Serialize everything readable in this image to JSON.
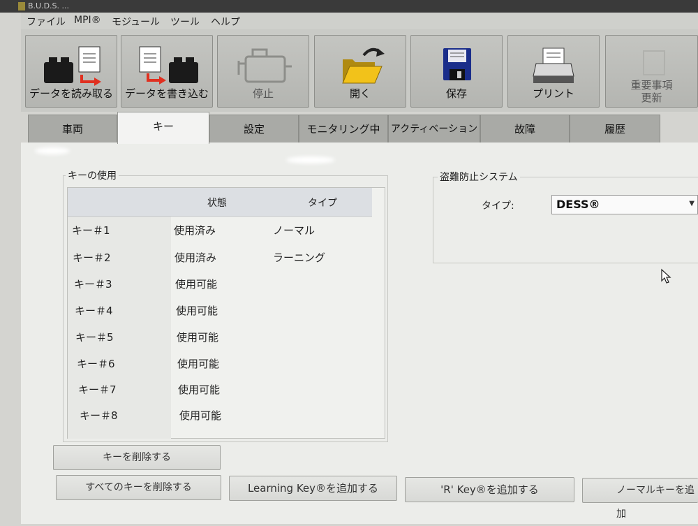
{
  "window": {
    "title": "B.U.D.S. ..."
  },
  "menu": {
    "items": [
      "ファイル",
      "MPI®",
      "モジュール",
      "ツール",
      "ヘルプ"
    ]
  },
  "toolbar": {
    "read_data": "データを読み取る",
    "write_data": "データを書き込む",
    "stop": "停止",
    "open": "開く",
    "save": "保存",
    "print": "プリント",
    "important_line1": "重要事項",
    "important_line2": "更新"
  },
  "tabs": [
    "車両",
    "キー",
    "設定",
    "モニタリング中",
    "アクティベーション",
    "故障",
    "履歴"
  ],
  "active_tab": "キー",
  "key_usage": {
    "title": "キーの使用",
    "headers": {
      "status": "状態",
      "type": "タイプ"
    },
    "rows": [
      {
        "key": "キー＃1",
        "status": "使用済み",
        "type": "ノーマル"
      },
      {
        "key": "キー＃2",
        "status": "使用済み",
        "type": "ラーニング"
      },
      {
        "key": "キー＃3",
        "status": "使用可能",
        "type": ""
      },
      {
        "key": "キー＃4",
        "status": "使用可能",
        "type": ""
      },
      {
        "key": "キー＃5",
        "status": "使用可能",
        "type": ""
      },
      {
        "key": "キー＃6",
        "status": "使用可能",
        "type": ""
      },
      {
        "key": "キー＃7",
        "status": "使用可能",
        "type": ""
      },
      {
        "key": "キー＃8",
        "status": "使用可能",
        "type": ""
      }
    ]
  },
  "anti_theft": {
    "title": "盗難防止システム",
    "type_label": "タイプ:",
    "type_value": "DESS®"
  },
  "buttons": {
    "delete_key": "キーを削除する",
    "delete_all_keys": "すべてのキーを削除する",
    "add_learning_key": "Learning Key®を追加する",
    "add_r_key": "'R' Key®を追加する",
    "add_normal_key": "ノーマルキーを追加"
  }
}
